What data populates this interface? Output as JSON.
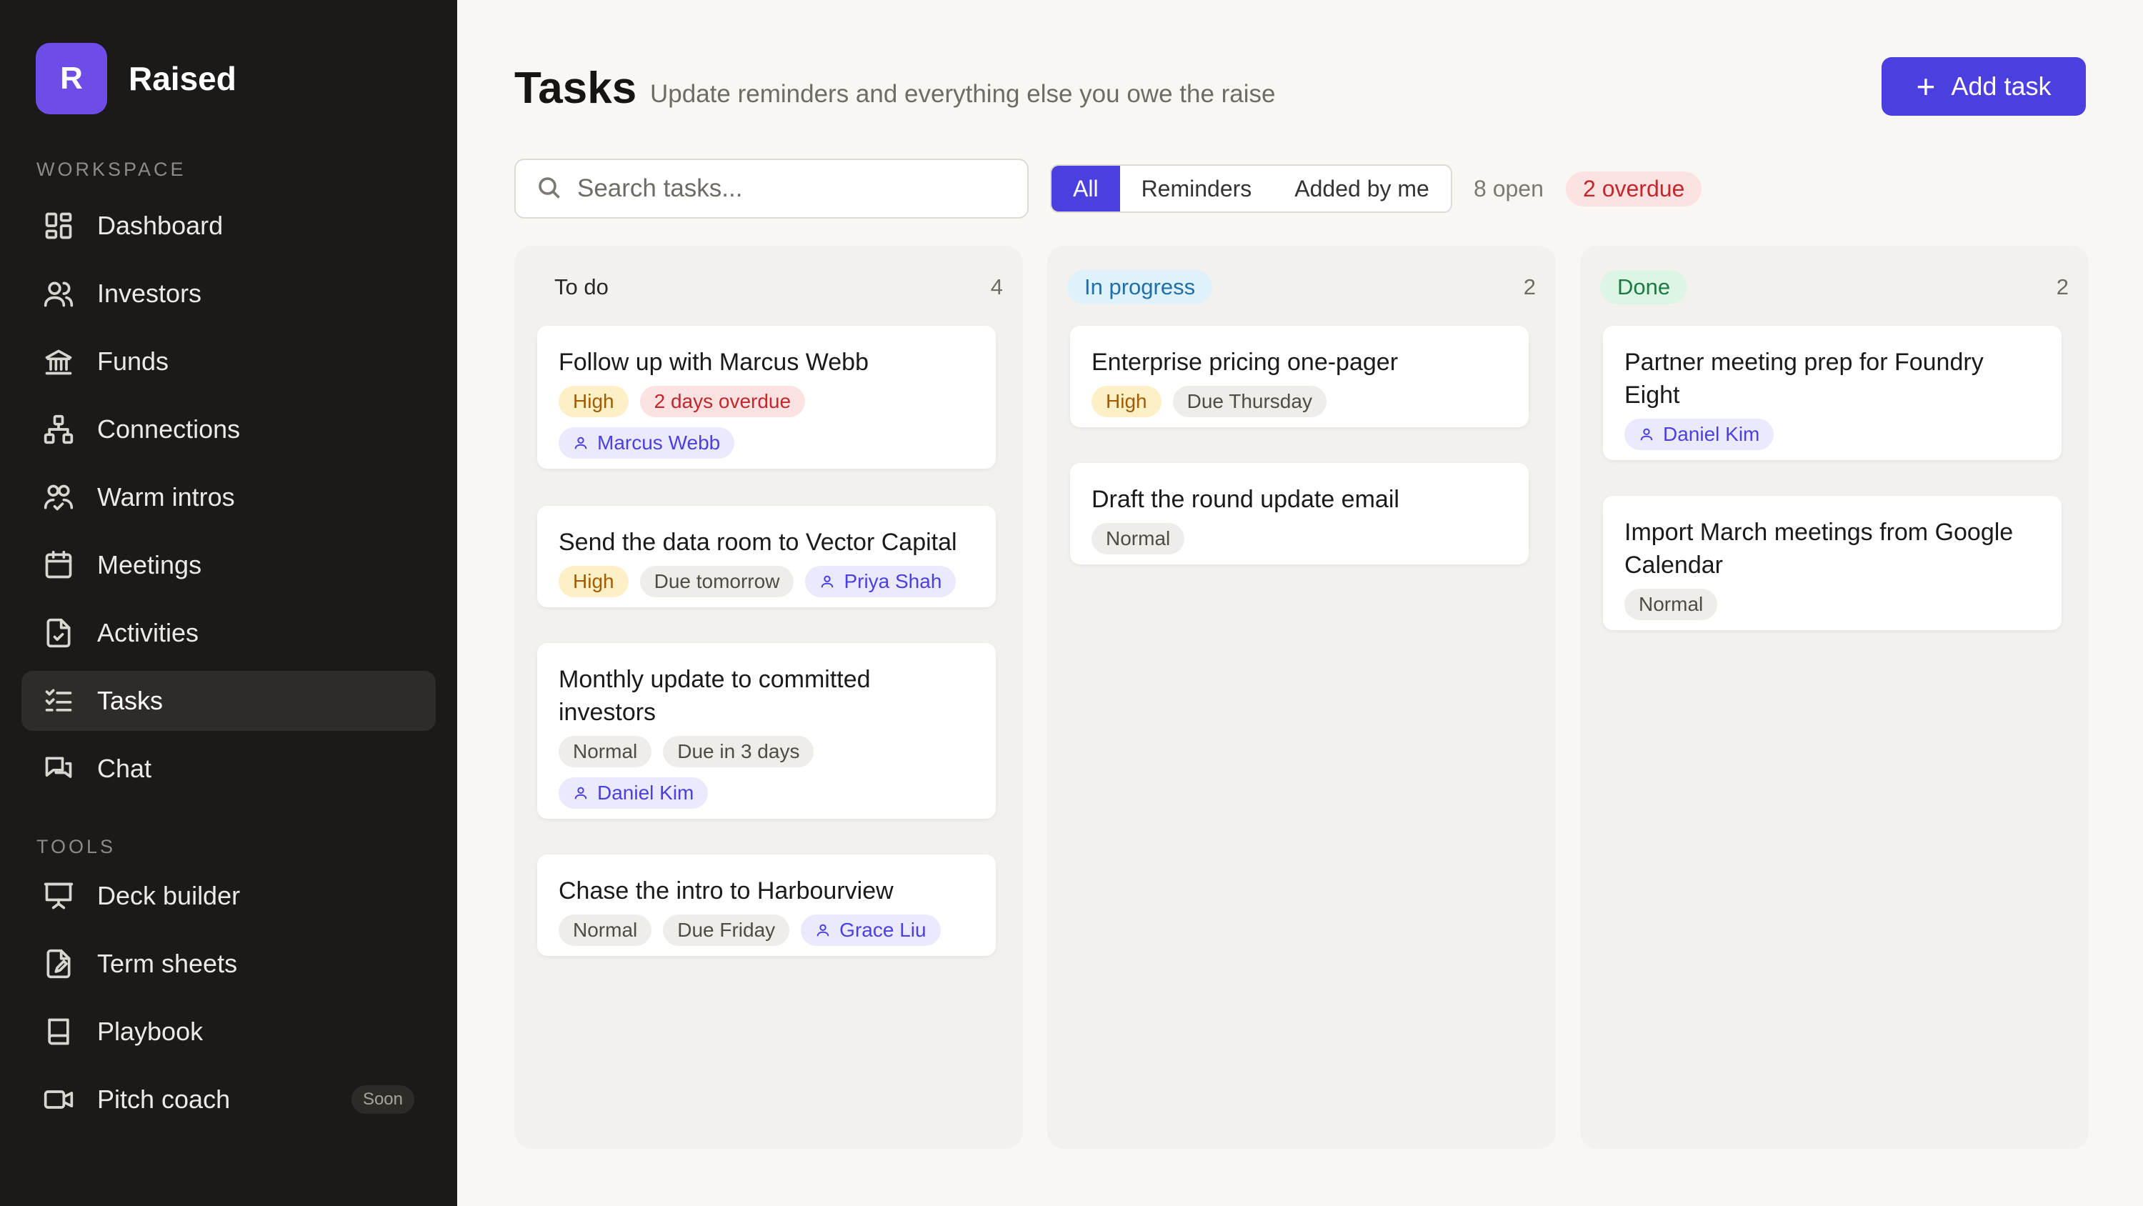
{
  "brand": {
    "initial": "R",
    "name": "Raised"
  },
  "sidebar": {
    "workspace_label": "WORKSPACE",
    "tools_label": "TOOLS",
    "workspace_items": [
      {
        "label": "Dashboard",
        "icon": "dashboard-icon"
      },
      {
        "label": "Investors",
        "icon": "users-icon"
      },
      {
        "label": "Funds",
        "icon": "bank-icon"
      },
      {
        "label": "Connections",
        "icon": "network-icon"
      },
      {
        "label": "Warm intros",
        "icon": "intro-icon"
      },
      {
        "label": "Meetings",
        "icon": "calendar-icon"
      },
      {
        "label": "Activities",
        "icon": "activity-icon"
      },
      {
        "label": "Tasks",
        "icon": "tasks-icon",
        "active": true
      },
      {
        "label": "Chat",
        "icon": "chat-icon"
      }
    ],
    "tools_items": [
      {
        "label": "Deck builder",
        "icon": "presentation-icon"
      },
      {
        "label": "Term sheets",
        "icon": "document-edit-icon"
      },
      {
        "label": "Playbook",
        "icon": "book-icon"
      },
      {
        "label": "Pitch coach",
        "icon": "video-icon",
        "badge": "Soon"
      }
    ]
  },
  "header": {
    "title": "Tasks",
    "subtitle": "Update reminders and everything else you owe the raise",
    "add_button": "Add task"
  },
  "toolbar": {
    "search_placeholder": "Search tasks...",
    "filters": [
      "All",
      "Reminders",
      "Added by me"
    ],
    "active_filter": "All",
    "open_count": "8 open",
    "overdue_count": "2 overdue"
  },
  "columns": [
    {
      "title": "To do",
      "count": "4",
      "cards": [
        {
          "title": "Follow up with Marcus Webb",
          "tags": [
            {
              "text": "High",
              "kind": "high"
            },
            {
              "text": "2 days overdue",
              "kind": "overdue"
            },
            {
              "text": "Marcus Webb",
              "kind": "person"
            }
          ]
        },
        {
          "title": "Send the data room to Vector Capital",
          "tags": [
            {
              "text": "High",
              "kind": "high"
            },
            {
              "text": "Due tomorrow",
              "kind": "neutral"
            },
            {
              "text": "Priya Shah",
              "kind": "person"
            }
          ]
        },
        {
          "title": "Monthly update to committed investors",
          "tags": [
            {
              "text": "Normal",
              "kind": "neutral"
            },
            {
              "text": "Due in 3 days",
              "kind": "neutral"
            },
            {
              "text": "Daniel Kim",
              "kind": "person"
            }
          ]
        },
        {
          "title": "Chase the intro to Harbourview",
          "tags": [
            {
              "text": "Normal",
              "kind": "neutral"
            },
            {
              "text": "Due Friday",
              "kind": "neutral"
            },
            {
              "text": "Grace Liu",
              "kind": "person"
            }
          ]
        }
      ]
    },
    {
      "title": "In progress",
      "count": "2",
      "pill_bg": "#dff1fb",
      "pill_color": "#1f6fa8",
      "cards": [
        {
          "title": "Enterprise pricing one-pager",
          "tags": [
            {
              "text": "High",
              "kind": "high"
            },
            {
              "text": "Due Thursday",
              "kind": "neutral"
            }
          ]
        },
        {
          "title": "Draft the round update email",
          "tags": [
            {
              "text": "Normal",
              "kind": "neutral"
            }
          ]
        }
      ]
    },
    {
      "title": "Done",
      "count": "2",
      "pill_bg": "#dcf5e5",
      "pill_color": "#1d7a45",
      "cards": [
        {
          "title": "Partner meeting prep for Foundry Eight",
          "tags": [
            {
              "text": "Daniel Kim",
              "kind": "person"
            }
          ]
        },
        {
          "title": "Import March meetings from Google Calendar",
          "tags": [
            {
              "text": "Normal",
              "kind": "neutral"
            }
          ]
        }
      ]
    }
  ],
  "colors": {
    "accent": "#4b3fe0",
    "sidebar_bg": "#1c1a19",
    "page_bg": "#f8f7f4"
  }
}
